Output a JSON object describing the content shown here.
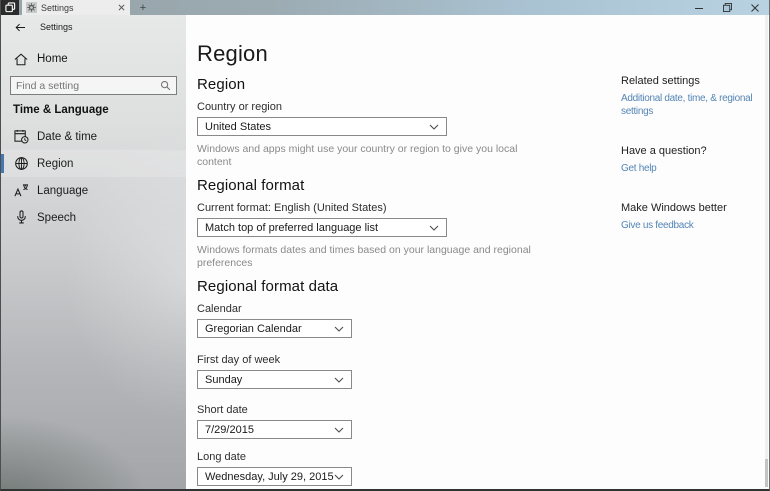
{
  "titlebar": {
    "tab_title": "Settings",
    "new_tab": "+"
  },
  "sidebar": {
    "back_label": "Settings",
    "home_label": "Home",
    "search_placeholder": "Find a setting",
    "group_header": "Time & Language",
    "items": [
      {
        "label": "Date & time"
      },
      {
        "label": "Region"
      },
      {
        "label": "Language"
      },
      {
        "label": "Speech"
      }
    ]
  },
  "main": {
    "page_title": "Region",
    "region_section": {
      "heading": "Region",
      "country_label": "Country or region",
      "country_value": "United States",
      "helper": "Windows and apps might use your country or region to give you local content"
    },
    "format_section": {
      "heading": "Regional format",
      "current_label": "Current format: English (United States)",
      "format_value": "Match top of preferred language list",
      "helper": "Windows formats dates and times based on your language and regional preferences"
    },
    "data_section": {
      "heading": "Regional format data",
      "calendar_label": "Calendar",
      "calendar_value": "Gregorian Calendar",
      "first_day_label": "First day of week",
      "first_day_value": "Sunday",
      "short_date_label": "Short date",
      "short_date_value": "7/29/2015",
      "long_date_label": "Long date",
      "long_date_value": "Wednesday, July 29, 2015"
    }
  },
  "right_rail": {
    "related_header": "Related settings",
    "related_link": "Additional date, time, & regional settings",
    "question_header": "Have a question?",
    "question_link": "Get help",
    "feedback_header": "Make Windows better",
    "feedback_link": "Give us feedback"
  },
  "colors": {
    "accent": "#4677ae",
    "link": "#5585b5",
    "titlebar_left": "#96a3a8",
    "titlebar_right": "#b9d2e2"
  }
}
